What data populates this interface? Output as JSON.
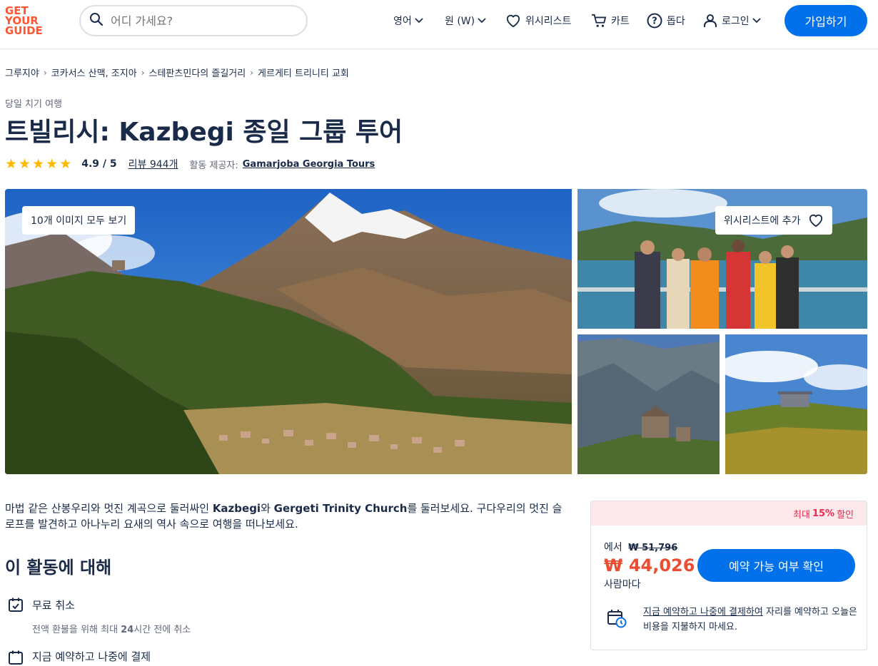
{
  "header": {
    "logo_line1": "GET",
    "logo_line2": "YOUR",
    "logo_line3": "GUIDE",
    "search_placeholder": "어디 가세요?",
    "language": "영어",
    "currency": "원 (W)",
    "wishlist": "위시리스트",
    "cart": "카트",
    "help": "돕다",
    "login": "로그인",
    "join": "가입하기"
  },
  "breadcrumb": [
    "그루지야",
    "코카서스 산맥, 조지아",
    "스테판츠민다의 즐길거리",
    "게르게티 트리니티 교회"
  ],
  "category": "당일 치기 여행",
  "title": "트빌리시: Kazbegi 종일 그룹 투어",
  "rating": {
    "score": 4.9,
    "value_text": "4.9 / 5",
    "reviews_text": "리뷰 944개",
    "provider_label": "활동 제공자:",
    "provider": "Gamarjoba Georgia Tours"
  },
  "gallery": {
    "all_images_label": "10개 이미지 모두 보기",
    "wishlist_add_label": "위시리스트에 추가"
  },
  "description": {
    "p1": "마법 같은 산봉우리와 멋진 계곡으로 둘러싸인 ",
    "b1": "Kazbegi",
    "p2": "와 ",
    "b2": "Gergeti Trinity Church",
    "p3": "를 둘러보세요. 구다우리의 멋진 슬로프를 발견하고 아나누리 요새의 역사 속으로 여행을 떠나보세요."
  },
  "about": {
    "heading": "이 활동에 대해",
    "features": [
      {
        "title": "무료 취소",
        "desc_pre": "전액 환불을 위해 최대 ",
        "desc_bold": "24",
        "desc_post": "시간 전에 취소"
      },
      {
        "title": "지금 예약하고 나중에 결제"
      }
    ]
  },
  "booking": {
    "discount_pre": "최대",
    "discount_bold": "15%",
    "discount_post": "할인",
    "from_label": "에서",
    "old_price": "₩ 51,796",
    "new_price": "₩ 44,026",
    "per_person": "사람마다",
    "check_button": "예약 가능 여부 확인",
    "reserve_link": "지금 예약하고 나중에 결제하여",
    "reserve_text": " 자리를 예약하고 오늘은 비용을 지불하지 마세요."
  },
  "colors": {
    "brand": "#ff5533",
    "primary_blue": "#0071eb",
    "star": "#ffb800",
    "discount_red": "#eb2a4b",
    "price_red": "#eb4d32",
    "text": "#1a2b49"
  }
}
